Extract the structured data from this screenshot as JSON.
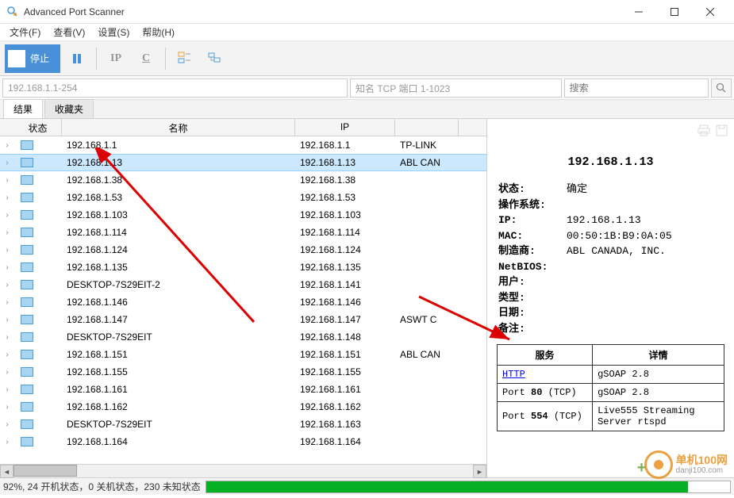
{
  "window": {
    "title": "Advanced Port Scanner"
  },
  "menu": {
    "file": "文件(F)",
    "view": "查看(V)",
    "settings": "设置(S)",
    "help": "帮助(H)"
  },
  "toolbar": {
    "stop": "停止",
    "ip_label": "IP",
    "c_label": "C"
  },
  "search": {
    "range": "192.168.1.1-254",
    "ports": "知名 TCP 端口 1-1023",
    "placeholder": "搜索"
  },
  "tabs": {
    "results": "结果",
    "favorites": "收藏夹"
  },
  "columns": {
    "status": "状态",
    "name": "名称",
    "ip": "IP"
  },
  "rows": [
    {
      "name": "192.168.1.1",
      "ip": "192.168.1.1",
      "mfr": "TP-LINK"
    },
    {
      "name": "192.168.1.13",
      "ip": "192.168.1.13",
      "mfr": "ABL CAN",
      "selected": true
    },
    {
      "name": "192.168.1.38",
      "ip": "192.168.1.38",
      "mfr": ""
    },
    {
      "name": "192.168.1.53",
      "ip": "192.168.1.53",
      "mfr": ""
    },
    {
      "name": "192.168.1.103",
      "ip": "192.168.1.103",
      "mfr": ""
    },
    {
      "name": "192.168.1.114",
      "ip": "192.168.1.114",
      "mfr": ""
    },
    {
      "name": "192.168.1.124",
      "ip": "192.168.1.124",
      "mfr": ""
    },
    {
      "name": "192.168.1.135",
      "ip": "192.168.1.135",
      "mfr": ""
    },
    {
      "name": "DESKTOP-7S29EIT-2",
      "ip": "192.168.1.141",
      "mfr": ""
    },
    {
      "name": "192.168.1.146",
      "ip": "192.168.1.146",
      "mfr": ""
    },
    {
      "name": "192.168.1.147",
      "ip": "192.168.1.147",
      "mfr": "ASWT C"
    },
    {
      "name": "DESKTOP-7S29EIT",
      "ip": "192.168.1.148",
      "mfr": ""
    },
    {
      "name": "192.168.1.151",
      "ip": "192.168.1.151",
      "mfr": "ABL CAN"
    },
    {
      "name": "192.168.1.155",
      "ip": "192.168.1.155",
      "mfr": ""
    },
    {
      "name": "192.168.1.161",
      "ip": "192.168.1.161",
      "mfr": ""
    },
    {
      "name": "192.168.1.162",
      "ip": "192.168.1.162",
      "mfr": ""
    },
    {
      "name": "DESKTOP-7S29EIT",
      "ip": "192.168.1.163",
      "mfr": ""
    },
    {
      "name": "192.168.1.164",
      "ip": "192.168.1.164",
      "mfr": ""
    }
  ],
  "detail": {
    "title": "192.168.1.13",
    "labels": {
      "status": "状态:",
      "os": "操作系统:",
      "ip": "IP:",
      "mac": "MAC:",
      "mfr": "制造商:",
      "netbios": "NetBIOS:",
      "user": "用户:",
      "type": "类型:",
      "date": "日期:",
      "notes": "备注:"
    },
    "values": {
      "status": "确定",
      "os": "",
      "ip": "192.168.1.13",
      "mac": "00:50:1B:B9:0A:05",
      "mfr": "ABL CANADA, INC.",
      "netbios": "",
      "user": "",
      "type": "",
      "date": "",
      "notes": ""
    }
  },
  "serviceTable": {
    "headers": {
      "service": "服务",
      "detail": "详情"
    },
    "rows": [
      {
        "svc": "HTTP",
        "link": true,
        "detail": "gSOAP 2.8"
      },
      {
        "svc_prefix": "Port ",
        "svc_bold": "80",
        "svc_suffix": " (TCP)",
        "detail": "gSOAP 2.8"
      },
      {
        "svc_prefix": "Port ",
        "svc_bold": "554",
        "svc_suffix": " (TCP)",
        "detail": "Live555 Streaming Server rtspd"
      }
    ]
  },
  "statusbar": {
    "text": "92%, 24 开机状态，0 关机状态，230 未知状态"
  },
  "watermark": {
    "brand": "单机100网",
    "url": "danji100.com"
  }
}
